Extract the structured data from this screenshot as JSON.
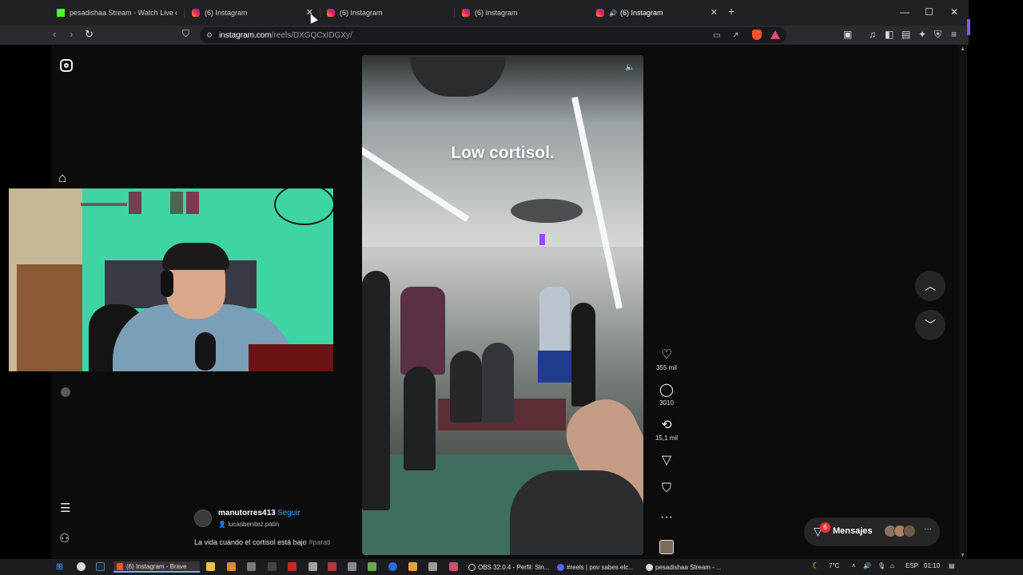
{
  "browser": {
    "tabs": [
      {
        "title": "pesadishaa Stream - Watch Live on K",
        "favicon": "kick-icon",
        "active": false
      },
      {
        "title": "(6) Instagram",
        "favicon": "instagram-icon",
        "active": false
      },
      {
        "title": "(6) Instagram",
        "favicon": "instagram-icon",
        "active": false
      },
      {
        "title": "(6) Instagram",
        "favicon": "instagram-icon",
        "active": false
      },
      {
        "title": "(6) Instagram",
        "favicon": "instagram-icon",
        "active": true
      }
    ],
    "tab_close_glyph": "✕",
    "new_tab_glyph": "+",
    "window_controls": {
      "minimize": "—",
      "maximize": "☐",
      "close": "✕"
    },
    "url": {
      "host": "instagram.com",
      "path": "/reels/DXGQCxIDGXy/"
    }
  },
  "instagram": {
    "reel_caption": "Low cortisol.",
    "actions": {
      "likes": "355 mil",
      "comments": "3010",
      "reposts": "15,1 mil"
    },
    "post": {
      "author": "manutorres413",
      "separator": "•",
      "follow_label": "Seguir",
      "collaborator": "lucasbenitez.patin",
      "caption": "La vida cuando el cortisol está bajo",
      "hashtag": "#parati"
    },
    "messages": {
      "label": "Mensajes",
      "badge": "6",
      "more": "···"
    }
  },
  "taskbar": {
    "items": [
      {
        "label": "(6) Instagram - Brave",
        "active": true
      },
      {
        "label": "OBS 32.0.4 - Perfil: Sin...",
        "active": false
      },
      {
        "label": "#reels | pov sabes elc...",
        "active": false
      },
      {
        "label": "pesadishaa Stream - ...",
        "active": false
      }
    ],
    "weather": "7°C",
    "language": "ESP",
    "time": "01:10"
  },
  "colors": {
    "accent_link": "#4f9cff",
    "badge_red": "#ff3040",
    "kick_green": "#53fc18"
  }
}
